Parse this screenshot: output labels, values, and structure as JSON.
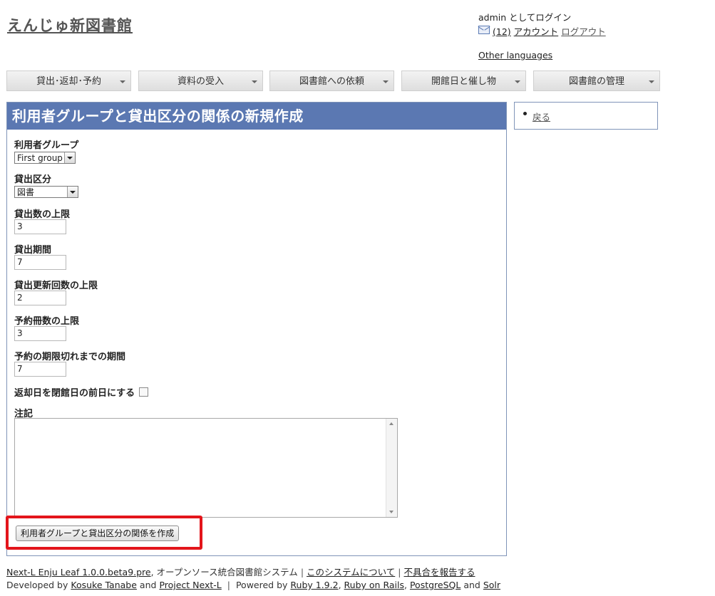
{
  "header": {
    "site_title": "えんじゅ新図書館",
    "login_status": "admin としてログイン",
    "message_count": "(12)",
    "account_link": "アカウント",
    "logout_link": "ログアウト",
    "other_languages": "Other languages"
  },
  "nav": {
    "items": [
      {
        "label": "貸出･返却･予約"
      },
      {
        "label": "資料の受入"
      },
      {
        "label": "図書館への依頼"
      },
      {
        "label": "開館日と催し物"
      },
      {
        "label": "図書館の管理"
      }
    ]
  },
  "main": {
    "title": "利用者グループと貸出区分の関係の新規作成",
    "fields": {
      "user_group": {
        "label": "利用者グループ",
        "value": "First group"
      },
      "checkout_type": {
        "label": "貸出区分",
        "value": "図書"
      },
      "checkout_limit": {
        "label": "貸出数の上限",
        "value": "3"
      },
      "checkout_period": {
        "label": "貸出期間",
        "value": "7"
      },
      "renewal_limit": {
        "label": "貸出更新回数の上限",
        "value": "2"
      },
      "reservation_limit": {
        "label": "予約冊数の上限",
        "value": "3"
      },
      "reservation_expiry": {
        "label": "予約の期限切れまでの期間",
        "value": "7"
      },
      "set_due_date_before_closing": {
        "label": "返却日を閉館日の前日にする",
        "checked": false
      },
      "note": {
        "label": "注記",
        "value": ""
      }
    },
    "submit_label": "利用者グループと貸出区分の関係を作成"
  },
  "sidebar": {
    "back_link": "戻る"
  },
  "footer": {
    "line1": {
      "product_link": "Next-L Enju Leaf 1.0.0.beta9.pre",
      "product_desc": ", オープンソース統合図書館システム",
      "sep": "|",
      "about_link": "このシステムについて",
      "report_link": "不具合を報告する"
    },
    "line2": {
      "developed_by": "Developed by",
      "author_link": "Kosuke Tanabe",
      "and1": "and",
      "project_link": "Project Next-L",
      "sep": "|",
      "powered_by": "Powered by",
      "ruby_link": "Ruby 1.9.2",
      "comma1": ",",
      "rails_link": "Ruby on Rails",
      "comma2": ",",
      "pg_link": "PostgreSQL",
      "and2": "and",
      "solr_link": "Solr"
    }
  }
}
